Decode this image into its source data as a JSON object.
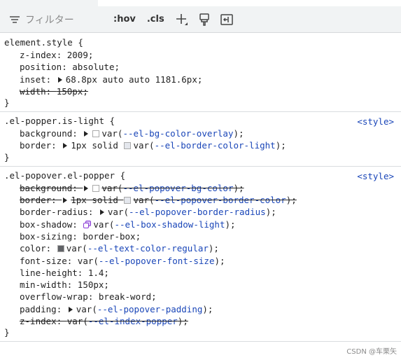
{
  "toolbar": {
    "filter_placeholder": "フィルター",
    "hov_label": ":hov",
    "cls_label": ".cls"
  },
  "rules": [
    {
      "selector": "element.style {",
      "source": "",
      "decls": [
        {
          "prop": "z-index",
          "val": "2009;",
          "strike": false
        },
        {
          "prop": "position",
          "val": "absolute;",
          "strike": false
        },
        {
          "prop": "inset",
          "val": "68.8px auto auto 1181.6px;",
          "strike": false,
          "tri": true
        },
        {
          "prop": "width",
          "val": "150px;",
          "strike": true
        }
      ]
    },
    {
      "selector": ".el-popper.is-light {",
      "source": "<style>",
      "decls": [
        {
          "prop": "background",
          "val": "var(--el-bg-color-overlay);",
          "tri": true,
          "swatch": "#ffffff"
        },
        {
          "prop": "border",
          "val": "1px solid var(--el-border-color-light);",
          "tri": true,
          "swatch": "#e4e7ed"
        }
      ]
    },
    {
      "selector": ".el-popover.el-popper {",
      "source": "<style>",
      "decls": [
        {
          "prop": "background",
          "val": "var(--el-popover-bg-color);",
          "strike": true,
          "tri": true,
          "swatch": "#ffffff"
        },
        {
          "prop": "border",
          "val": "1px solid var(--el-popover-border-color);",
          "strike": true,
          "tri": true,
          "swatch": "#e4e7ed"
        },
        {
          "prop": "border-radius",
          "val": "var(--el-popover-border-radius);",
          "tri": true
        },
        {
          "prop": "box-shadow",
          "val": "var(--el-box-shadow-light);",
          "shadow": true
        },
        {
          "prop": "box-sizing",
          "val": "border-box;"
        },
        {
          "prop": "color",
          "val": "var(--el-text-color-regular);",
          "swatch": "#606266"
        },
        {
          "prop": "font-size",
          "val": "var(--el-popover-font-size);"
        },
        {
          "prop": "line-height",
          "val": "1.4;"
        },
        {
          "prop": "min-width",
          "val": "150px;"
        },
        {
          "prop": "overflow-wrap",
          "val": "break-word;"
        },
        {
          "prop": "padding",
          "val": "var(--el-popover-padding);",
          "tri": true
        },
        {
          "prop": "z-index",
          "val": "var(--el-index-popper);",
          "strike": true
        }
      ]
    }
  ],
  "close_brace": "}",
  "watermark": "CSDN @车栗矢"
}
